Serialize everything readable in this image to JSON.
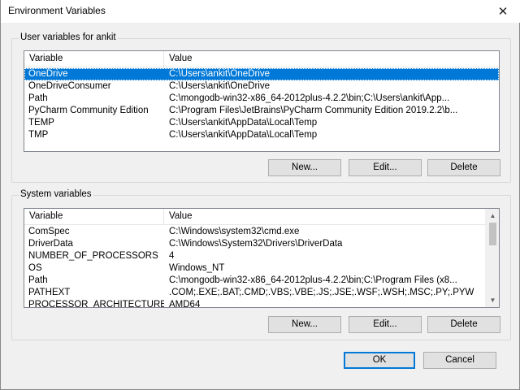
{
  "window": {
    "title": "Environment Variables",
    "close_glyph": "✕"
  },
  "user_vars": {
    "group_label": "User variables for ankit",
    "columns": {
      "variable": "Variable",
      "value": "Value"
    },
    "rows": [
      {
        "name": "OneDrive",
        "value": "C:\\Users\\ankit\\OneDrive",
        "selected": true
      },
      {
        "name": "OneDriveConsumer",
        "value": "C:\\Users\\ankit\\OneDrive"
      },
      {
        "name": "Path",
        "value": "C:\\mongodb-win32-x86_64-2012plus-4.2.2\\bin;C:\\Users\\ankit\\App..."
      },
      {
        "name": "PyCharm Community Edition",
        "value": "C:\\Program Files\\JetBrains\\PyCharm Community Edition 2019.2.2\\b..."
      },
      {
        "name": "TEMP",
        "value": "C:\\Users\\ankit\\AppData\\Local\\Temp"
      },
      {
        "name": "TMP",
        "value": "C:\\Users\\ankit\\AppData\\Local\\Temp"
      }
    ],
    "buttons": {
      "new": "New...",
      "edit": "Edit...",
      "delete": "Delete"
    }
  },
  "system_vars": {
    "group_label": "System variables",
    "columns": {
      "variable": "Variable",
      "value": "Value"
    },
    "rows": [
      {
        "name": "ComSpec",
        "value": "C:\\Windows\\system32\\cmd.exe"
      },
      {
        "name": "DriverData",
        "value": "C:\\Windows\\System32\\Drivers\\DriverData"
      },
      {
        "name": "NUMBER_OF_PROCESSORS",
        "value": "4"
      },
      {
        "name": "OS",
        "value": "Windows_NT"
      },
      {
        "name": "Path",
        "value": "C:\\mongodb-win32-x86_64-2012plus-4.2.2\\bin;C:\\Program Files (x8..."
      },
      {
        "name": "PATHEXT",
        "value": ".COM;.EXE;.BAT;.CMD;.VBS;.VBE;.JS;.JSE;.WSF;.WSH;.MSC;.PY;.PYW"
      },
      {
        "name": "PROCESSOR_ARCHITECTURE",
        "value": "AMD64"
      }
    ],
    "buttons": {
      "new": "New...",
      "edit": "Edit...",
      "delete": "Delete"
    },
    "scrollbar": {
      "up_glyph": "▲",
      "down_glyph": "▼"
    }
  },
  "footer": {
    "ok": "OK",
    "cancel": "Cancel"
  },
  "colors": {
    "selection": "#0078d7",
    "dialog_bg": "#f0f0f0"
  }
}
